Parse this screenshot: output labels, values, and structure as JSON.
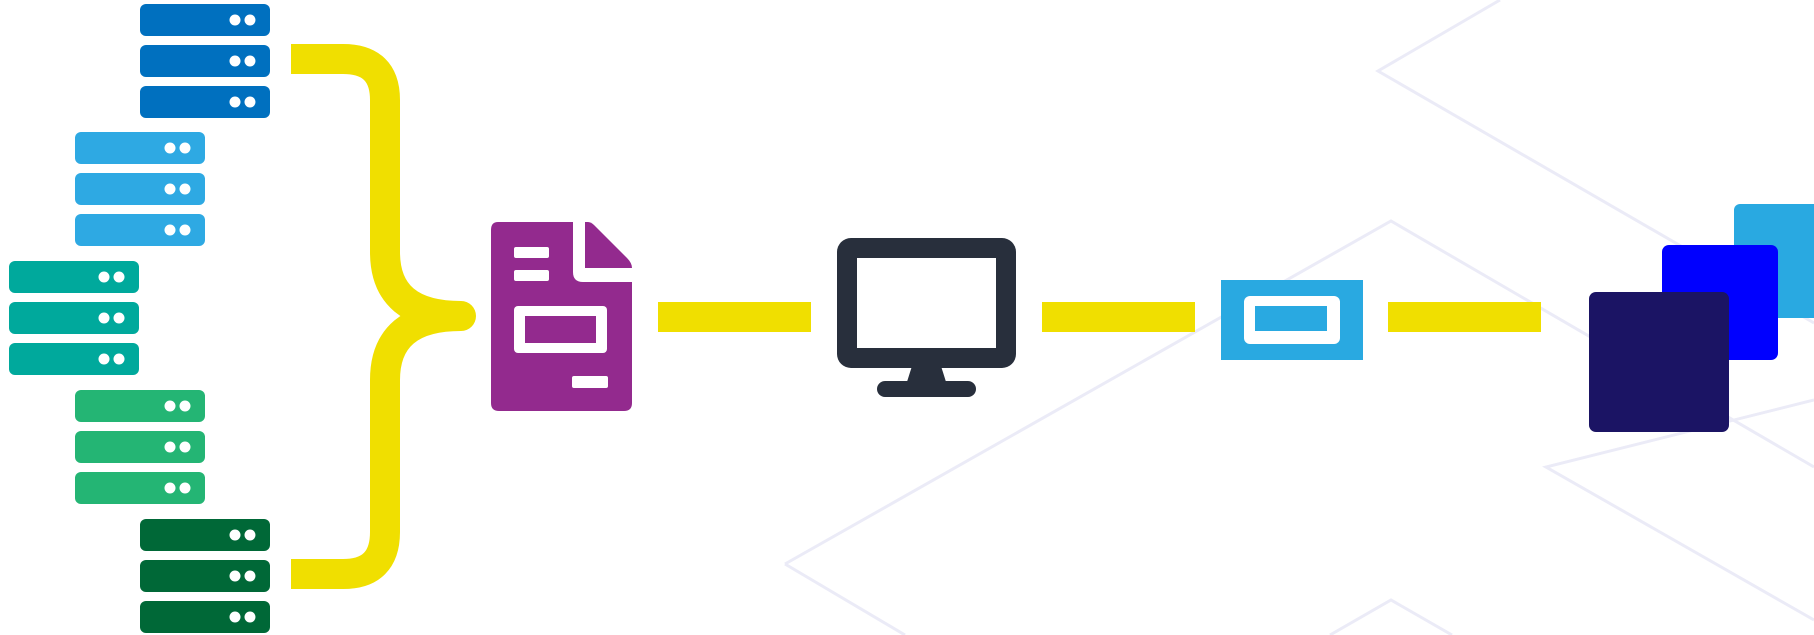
{
  "colors": {
    "background": "#ffffff",
    "background_lines": "#ebebf7",
    "connector": "#f0df00",
    "server_dots": "#ffffff",
    "document": "#932a8e",
    "monitor": "#282f3c",
    "window": "#29a9e1",
    "stack_back": "#29a9e1",
    "stack_middle": "#0000ff",
    "stack_front": "#1b1464"
  },
  "server_groups": [
    {
      "name": "server-group-1",
      "color": "#0070bf",
      "units": 3
    },
    {
      "name": "server-group-2",
      "color": "#2ea9e3",
      "units": 3
    },
    {
      "name": "server-group-3",
      "color": "#00a99c",
      "units": 3
    },
    {
      "name": "server-group-4",
      "color": "#24b574",
      "units": 3
    },
    {
      "name": "server-group-5",
      "color": "#006837",
      "units": 3
    }
  ],
  "flow_nodes": [
    {
      "name": "document-icon",
      "semantic": "report-document"
    },
    {
      "name": "monitor-icon",
      "semantic": "desktop-monitor"
    },
    {
      "name": "window-icon",
      "semantic": "application-window"
    },
    {
      "name": "stacked-squares-icon",
      "semantic": "layered-output"
    }
  ]
}
